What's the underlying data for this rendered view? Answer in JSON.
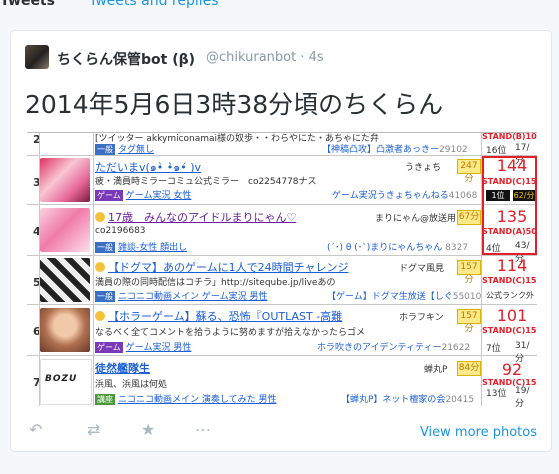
{
  "tabs": {
    "tweets": "Tweets",
    "replies": "Tweets and replies"
  },
  "tweet": {
    "display_name": "ちくらん保管bot (β)",
    "handle": "@chikuranbot · 4s",
    "text": "2014年5月6日3時38分頃のちくらん"
  },
  "ranking": {
    "rows": [
      {
        "rank": "2",
        "desc": "[ツイッター akkymiconamai様の奴歩・・わらやにた・あちゃにた弁",
        "cat_tag": "一般",
        "tags": "タグ無し",
        "community": "【神稿凸攻】凸激者あっきー",
        "cnum": "29102",
        "stand": "STAND(B)1000",
        "place": "16位",
        "pos2": "17/分"
      },
      {
        "rank": "3",
        "title": "ただいまv(๑•̀ •̀๑•́ )v",
        "owner": "うきょち",
        "badge": "247分",
        "viewers": "144",
        "stand": "STAND(C)1500",
        "desc": "疲・満員時ミラーコミュ公式ミラー　co2254778ナス",
        "cat_tag": "ゲーム",
        "tags": "ゲーム実況 女性",
        "community": "ゲーム実況うきょちゃんねる",
        "cnum": "41068",
        "place": "1位",
        "pos2": "62/分"
      },
      {
        "rank": "4",
        "title": "17歳　みんなのアイドルまりにゃん♡",
        "owner": "まりにゃん@放送用",
        "badge": "67分",
        "viewers": "135",
        "stand": "STAND(A)500",
        "desc": "co2196683",
        "cat_tag": "一般",
        "tags": "雑談-女性 顔出し",
        "community": "(´･) θ (･`)まりにゃんちゃん",
        "cnum": "8327",
        "place": "4位",
        "pos2": "43/分"
      },
      {
        "rank": "5",
        "title": "【ドグマ】あのゲームに1人で24時間チャレンジ",
        "owner": "ドグマ風見",
        "badge": "157分",
        "viewers": "114",
        "stand": "STAND(C)1500",
        "desc": "満員の際の同時配信はコチラ」http://siteqube.jp/liveあの",
        "cat_tag": "一般",
        "tags": "ニコニコ動画メイン ゲーム実況 男性",
        "community": "【ゲーム】ドグマ生放送【しぐ",
        "cnum": "55010",
        "place": "公式ランク外",
        "pos2": ""
      },
      {
        "rank": "6",
        "title": "【ホラーゲーム】蘇る、恐怖『OUTLAST -高難",
        "owner": "ホラフキン",
        "badge": "157分",
        "viewers": "101",
        "stand": "STAND(C)1500",
        "desc": "なるべく全てコメントを拾うように努めますが拾えなかったらゴメ",
        "cat_tag": "ゲーム",
        "tags": "ゲーム実況 男性",
        "community": "ホラ吹きのアイデンティティー",
        "cnum": "21622",
        "place": "7位",
        "pos2": "31/分"
      },
      {
        "rank": "7",
        "title": "徒然艦隊生",
        "owner": "蝉丸P",
        "badge": "84分",
        "viewers": "92",
        "stand": "STAND(C)1500",
        "desc": "浜風、浜風は何処",
        "cat_tag": "講座",
        "tags": "ニコニコ動画メイン 演奏してみた 男性",
        "community": "【蝉丸P】ネット檀家の会",
        "cnum": "20415",
        "place": "13位",
        "pos2": "19/分",
        "thumb_text": "BOZU"
      }
    ]
  },
  "actions": {
    "reply": "reply-icon",
    "retweet": "retweet-icon",
    "favorite": "star-icon",
    "more": "more-icon"
  },
  "view_more": "View more photos",
  "colors": {
    "link": "#1b95e0",
    "rank_red": "#e0202a",
    "border": "#e1e8ed"
  }
}
